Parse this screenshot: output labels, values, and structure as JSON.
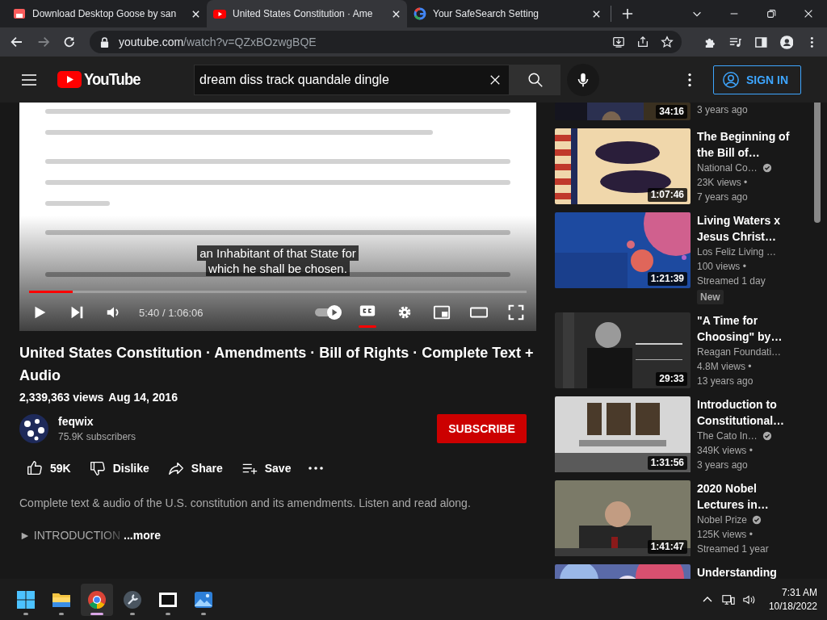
{
  "browser": {
    "tabs": [
      {
        "title": "Download Desktop Goose by san",
        "kind": "store",
        "selected": false
      },
      {
        "title": "United States Constitution · Ame",
        "kind": "video",
        "selected": true
      },
      {
        "title": "Your SafeSearch Setting",
        "kind": "search",
        "selected": false
      }
    ],
    "address": {
      "domain": "youtube.com",
      "path": "/watch?v=QZxBOzwgBQE"
    }
  },
  "header": {
    "logo": "YouTube",
    "search": {
      "value": "dream diss track quandale dingle"
    },
    "sign_in": "SIGN IN"
  },
  "player": {
    "caption": [
      "an Inhabitant of that State for",
      "which he shall be chosen."
    ],
    "progress": {
      "level": 0.088
    },
    "time": "5:40 / 1:06:06",
    "captions_on": true
  },
  "video": {
    "title": "United States Constitution · Amendments · Bill of Rights · Complete Text + Audio",
    "views": "2,339,363 views",
    "date": "Aug 14, 2016",
    "channel": {
      "name": "feqwix",
      "subscribers": "75.9K subscribers"
    },
    "subscribe": "SUBSCRIBE",
    "actions": [
      {
        "kind": "like",
        "label": "59K"
      },
      {
        "kind": "dislike",
        "label": "Dislike"
      },
      {
        "kind": "share",
        "label": "Share"
      },
      {
        "kind": "save",
        "label": "Save"
      },
      {
        "kind": "more"
      }
    ],
    "description": "Complete text & audio of the U.S. constitution and its amendments. Listen and read along.",
    "chapter": "► INTRODUCTION",
    "more": "...more"
  },
  "sidebar": {
    "partial": {
      "duration": "34:16",
      "age": "3 years ago"
    },
    "items": [
      {
        "title": "The Beginning of the Bill of…",
        "channel": "National Co…",
        "verified": true,
        "views": "23K views •",
        "age": "7 years ago",
        "duration": "1:07:46"
      },
      {
        "title": "Living Waters x Jesus Christ…",
        "channel": "Los Feliz Living …",
        "verified": false,
        "views": "100 views •",
        "age": "Streamed 1 day",
        "badge": "New",
        "duration": "1:21:39"
      },
      {
        "title": "\"A Time for Choosing\" by…",
        "channel": "Reagan Foundati…",
        "verified": false,
        "views": "4.8M views •",
        "age": "13 years ago",
        "duration": "29:33"
      },
      {
        "title": "Introduction to Constitutional…",
        "channel": "The Cato In…",
        "verified": true,
        "views": "349K views •",
        "age": "3 years ago",
        "duration": "1:31:56"
      },
      {
        "title": "2020 Nobel Lectures in…",
        "channel": "Nobel Prize",
        "verified": true,
        "views": "125K views •",
        "age": "Streamed 1 year",
        "duration": "1:41:47"
      },
      {
        "title": "Understanding"
      }
    ]
  },
  "taskbar": {
    "apps": [
      {
        "kind": "start",
        "selected": false
      },
      {
        "kind": "folder",
        "selected": false
      },
      {
        "kind": "browser",
        "selected": true
      },
      {
        "kind": "tool",
        "selected": false
      },
      {
        "kind": "archive",
        "selected": false
      },
      {
        "kind": "photos",
        "selected": false
      }
    ],
    "time": "7:31 AM",
    "date": "10/18/2022"
  }
}
